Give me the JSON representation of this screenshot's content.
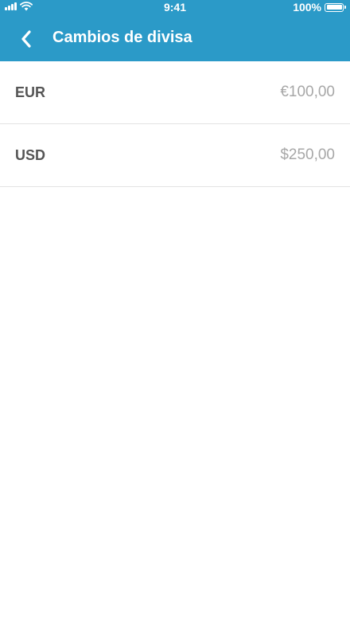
{
  "status_bar": {
    "time": "9:41",
    "battery_text": "100%",
    "icons": [
      "signal-icon",
      "wifi-icon",
      "battery-icon"
    ]
  },
  "header": {
    "title": "Cambios de divisa",
    "back_icon": "chevron-left-icon",
    "color": "#2b9ac8"
  },
  "currencies": [
    {
      "code": "EUR",
      "amount": "€100,00"
    },
    {
      "code": "USD",
      "amount": "$250,00"
    }
  ]
}
